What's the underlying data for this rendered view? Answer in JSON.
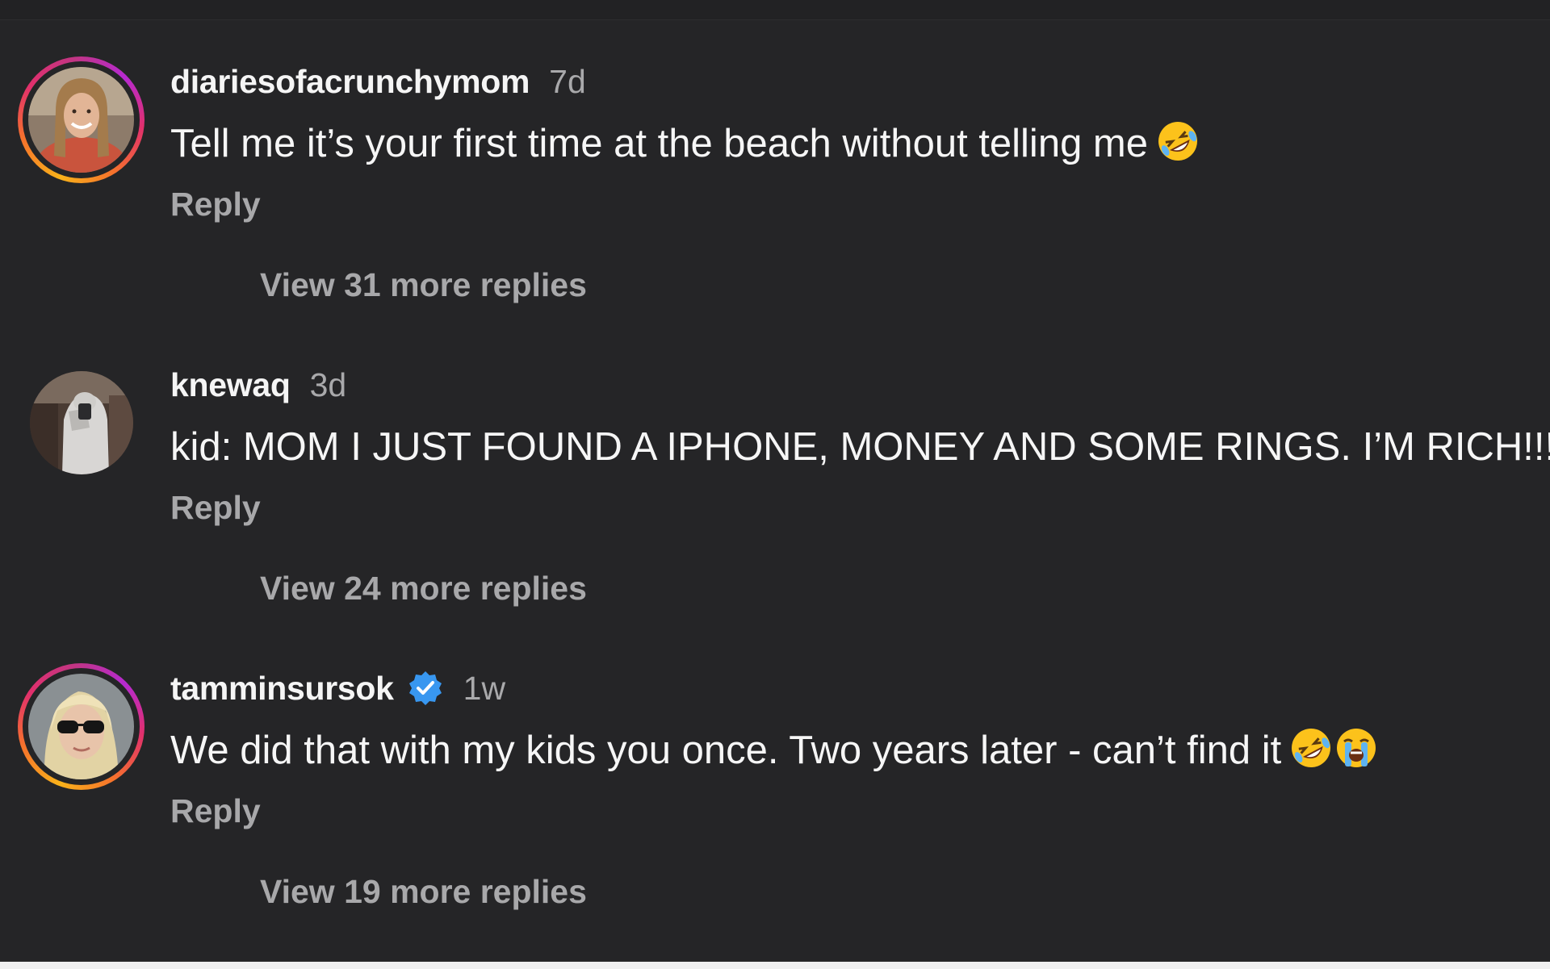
{
  "comments": [
    {
      "username": "diariesofacrunchymom",
      "time": "7d",
      "verified": false,
      "text": "Tell me it’s your first time at the beach without telling me",
      "emojis": [
        "rolling-on-floor-laughing-emoji"
      ],
      "reply_label": "Reply",
      "view_replies_label": "View 31 more replies"
    },
    {
      "username": "knewaq",
      "time": "3d",
      "verified": false,
      "text": "kid: MOM I JUST FOUND A IPHONE, MONEY AND SOME RINGS. I’M RICH!!!",
      "emojis": [],
      "reply_label": "Reply",
      "view_replies_label": "View 24 more replies"
    },
    {
      "username": "tamminsursok",
      "time": "1w",
      "verified": true,
      "text": "We did that with my kids you once. Two years later - can’t find it",
      "emojis": [
        "rolling-on-floor-laughing-emoji",
        "loudly-crying-emoji"
      ],
      "reply_label": "Reply",
      "view_replies_label": "View 19 more replies"
    }
  ],
  "colors": {
    "background": "#252527",
    "primary_text": "#f5f5f5",
    "secondary_text": "#a8a8aa",
    "verified_blue": "#3897f0"
  }
}
